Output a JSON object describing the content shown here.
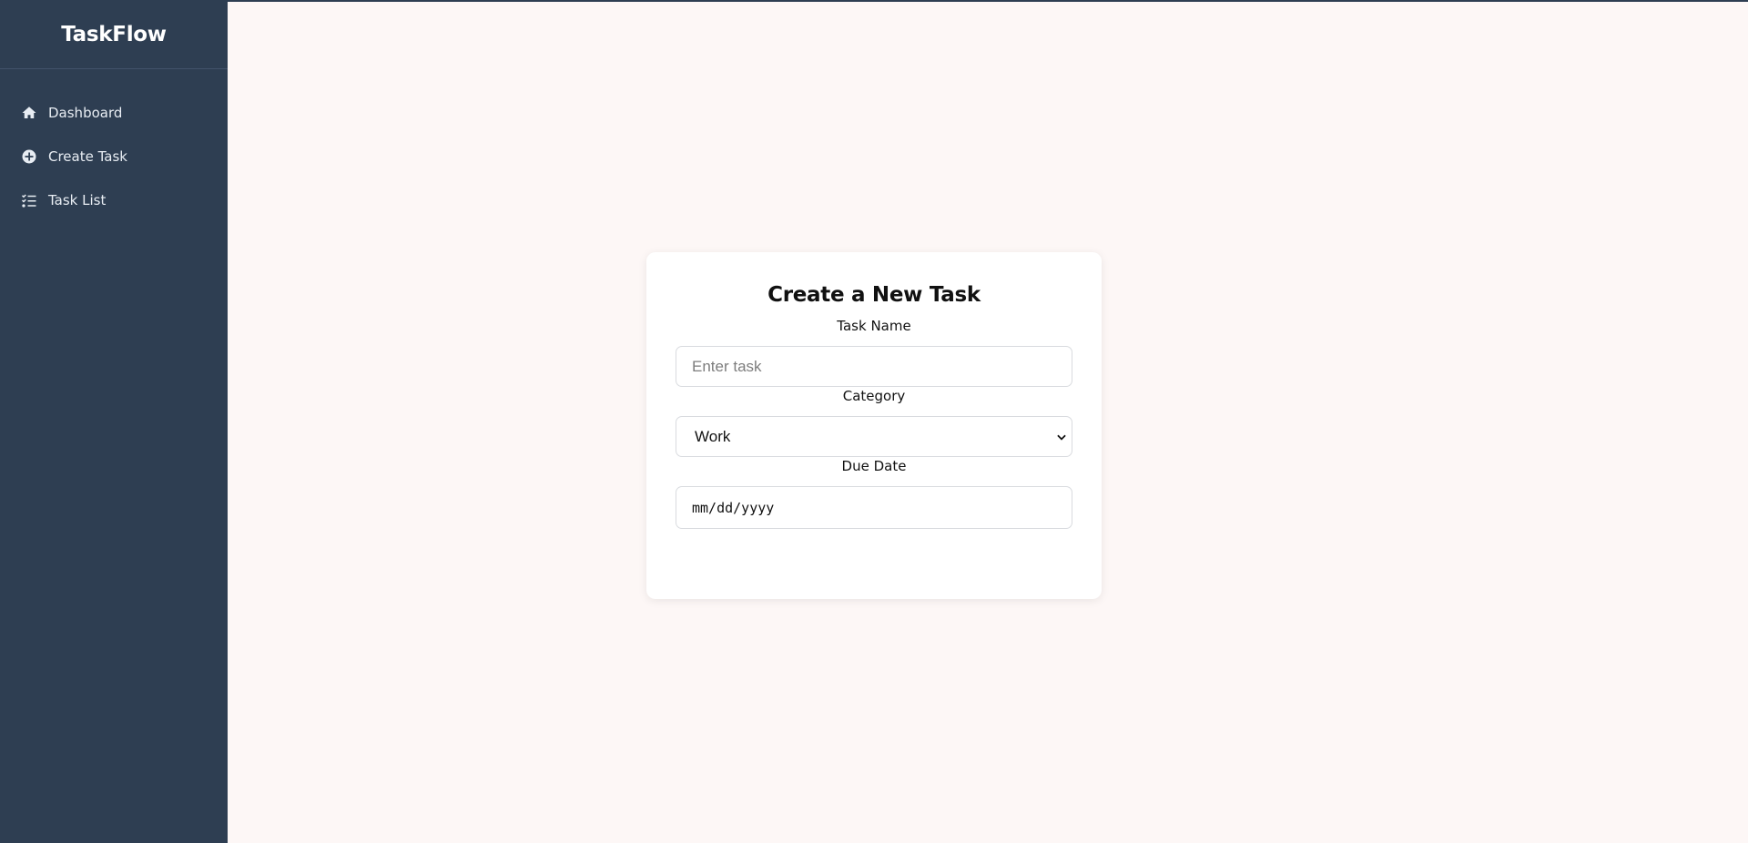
{
  "sidebar": {
    "brand": "TaskFlow",
    "items": [
      {
        "label": "Dashboard",
        "icon": "home-icon"
      },
      {
        "label": "Create Task",
        "icon": "plus-circle-icon"
      },
      {
        "label": "Task List",
        "icon": "list-check-icon"
      }
    ]
  },
  "form": {
    "title": "Create a New Task",
    "task_name": {
      "label": "Task Name",
      "placeholder": "Enter task",
      "value": ""
    },
    "category": {
      "label": "Category",
      "selected": "Work"
    },
    "due_date": {
      "label": "Due Date",
      "placeholder": "mm/dd/yyyy"
    }
  },
  "colors": {
    "sidebar_bg": "#2e3e52",
    "page_bg": "#fdf7f6",
    "card_bg": "#ffffff"
  }
}
